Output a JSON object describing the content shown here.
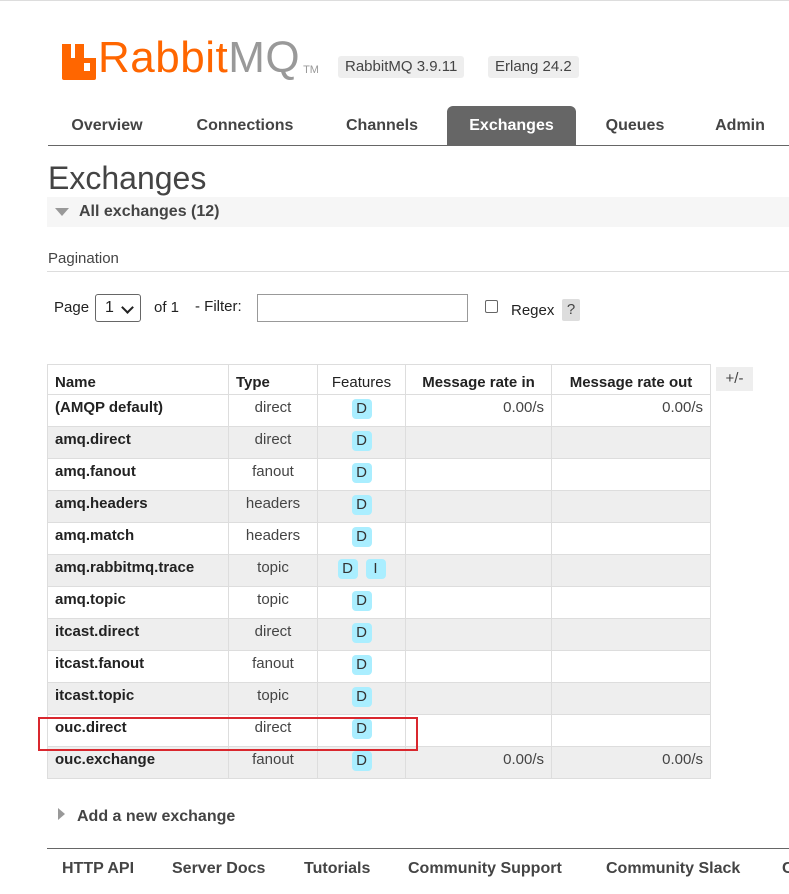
{
  "brand": {
    "logo_rabbit": "Rabbit",
    "logo_mq": "MQ",
    "logo_tm": "TM",
    "brand_color": "#ff6600"
  },
  "header": {
    "rabbitmq_version": "RabbitMQ 3.9.11",
    "erlang_version": "Erlang 24.2"
  },
  "nav": {
    "tabs": [
      {
        "label": "Overview"
      },
      {
        "label": "Connections"
      },
      {
        "label": "Channels"
      },
      {
        "label": "Exchanges",
        "active": true
      },
      {
        "label": "Queues"
      },
      {
        "label": "Admin"
      }
    ],
    "active_color": "#666666"
  },
  "page": {
    "title": "Exchanges",
    "section_label": "All exchanges (12)"
  },
  "pagination": {
    "title": "Pagination",
    "page_label": "Page",
    "page_value": "1",
    "of_label": "of 1",
    "filter_label": "- Filter:",
    "filter_value": "",
    "regex_label": "Regex",
    "help_label": "?"
  },
  "table": {
    "columns": [
      "Name",
      "Type",
      "Features",
      "Message rate in",
      "Message rate out"
    ],
    "toggle_label": "+/-",
    "rows": [
      {
        "name": "(AMQP default)",
        "type": "direct",
        "features": [
          "D"
        ],
        "rate_in": "0.00/s",
        "rate_out": "0.00/s"
      },
      {
        "name": "amq.direct",
        "type": "direct",
        "features": [
          "D"
        ],
        "rate_in": "",
        "rate_out": ""
      },
      {
        "name": "amq.fanout",
        "type": "fanout",
        "features": [
          "D"
        ],
        "rate_in": "",
        "rate_out": ""
      },
      {
        "name": "amq.headers",
        "type": "headers",
        "features": [
          "D"
        ],
        "rate_in": "",
        "rate_out": ""
      },
      {
        "name": "amq.match",
        "type": "headers",
        "features": [
          "D"
        ],
        "rate_in": "",
        "rate_out": ""
      },
      {
        "name": "amq.rabbitmq.trace",
        "type": "topic",
        "features": [
          "D",
          "I"
        ],
        "rate_in": "",
        "rate_out": ""
      },
      {
        "name": "amq.topic",
        "type": "topic",
        "features": [
          "D"
        ],
        "rate_in": "",
        "rate_out": ""
      },
      {
        "name": "itcast.direct",
        "type": "direct",
        "features": [
          "D"
        ],
        "rate_in": "",
        "rate_out": ""
      },
      {
        "name": "itcast.fanout",
        "type": "fanout",
        "features": [
          "D"
        ],
        "rate_in": "",
        "rate_out": ""
      },
      {
        "name": "itcast.topic",
        "type": "topic",
        "features": [
          "D"
        ],
        "rate_in": "",
        "rate_out": ""
      },
      {
        "name": "ouc.direct",
        "type": "direct",
        "features": [
          "D"
        ],
        "rate_in": "",
        "rate_out": ""
      },
      {
        "name": "ouc.exchange",
        "type": "fanout",
        "features": [
          "D"
        ],
        "rate_in": "0.00/s",
        "rate_out": "0.00/s"
      }
    ],
    "feature_badge_color": "#aaeeff",
    "highlight_color": "#d9272e"
  },
  "add_exchange": {
    "label": "Add a new exchange"
  },
  "footer": {
    "links": [
      "HTTP API",
      "Server Docs",
      "Tutorials",
      "Community Support",
      "Community Slack",
      "C"
    ]
  }
}
